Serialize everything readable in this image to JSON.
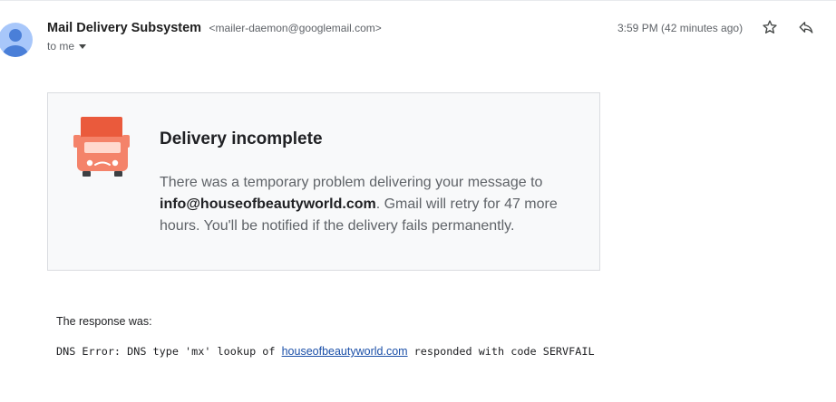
{
  "header": {
    "sender_name": "Mail Delivery Subsystem",
    "sender_email": "<mailer-daemon@googlemail.com>",
    "recipient": "to me",
    "timestamp": "3:59 PM (42 minutes ago)"
  },
  "card": {
    "title": "Delivery incomplete",
    "body_prefix": "There was a temporary problem delivering your message to ",
    "recipient_address": "info@houseofbeautyworld.com",
    "body_suffix": ". Gmail will retry for 47 more hours. You'll be notified if the delivery fails permanently."
  },
  "response": {
    "label": "The response was:",
    "error_prefix": "DNS Error: DNS type 'mx' lookup of ",
    "domain_link": "houseofbeautyworld.com",
    "error_suffix": " responded with code SERVFAIL"
  },
  "icons": {
    "avatar": "avatar-icon",
    "star": "star-icon",
    "reply": "reply-icon",
    "truck": "delivery-truck-icon"
  },
  "colors": {
    "truck_orange": "#f4836a",
    "truck_dark": "#ea5a3c",
    "link": "#1a4fa8",
    "avatar": "#8ab4f8"
  }
}
